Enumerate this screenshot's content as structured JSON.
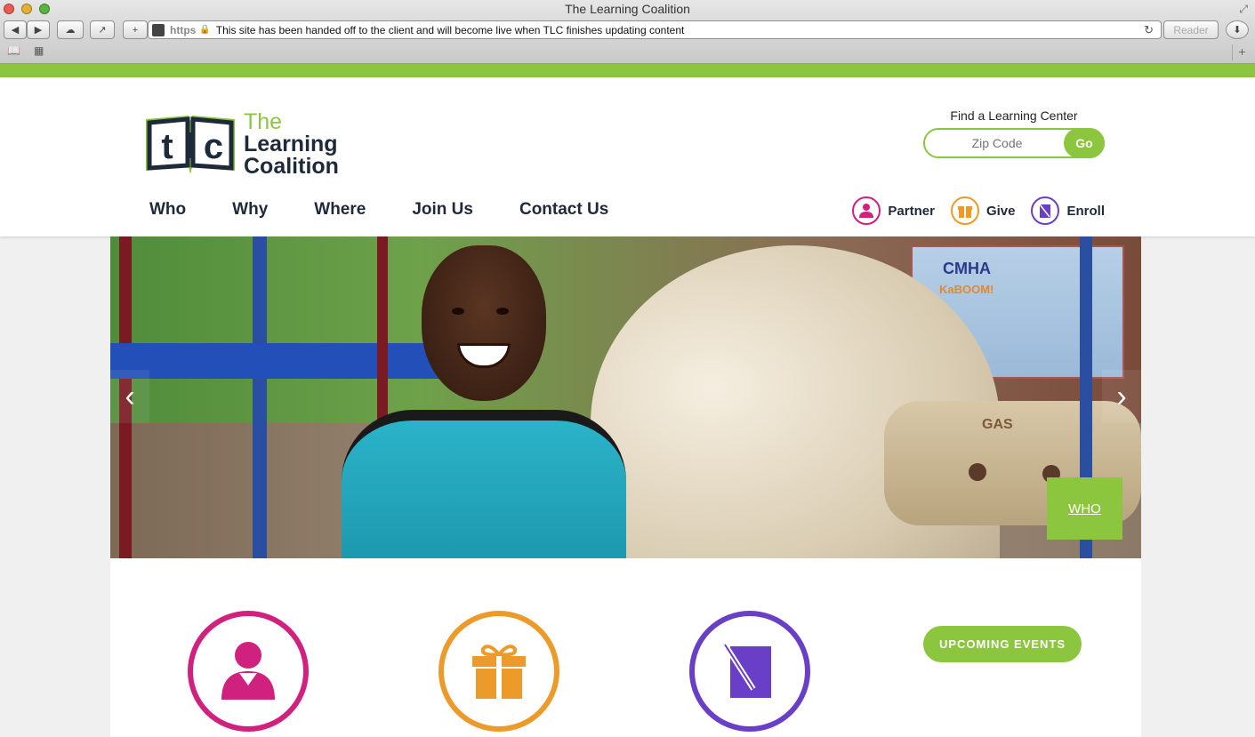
{
  "browser": {
    "title": "The Learning Coalition",
    "url_scheme": "https",
    "url_text": "This site has been handed off to the client and will become live when TLC finishes updating content",
    "reader_label": "Reader"
  },
  "brand": {
    "logo_mark": "tlc",
    "logo_line1": "The",
    "logo_line2": "Learning",
    "logo_line3": "Coalition",
    "green": "#8cc63f",
    "navy": "#1e2a3a"
  },
  "search": {
    "label": "Find a Learning Center",
    "placeholder": "Zip Code",
    "button": "Go"
  },
  "nav": {
    "items": [
      {
        "label": "Who"
      },
      {
        "label": "Why"
      },
      {
        "label": "Where"
      },
      {
        "label": "Join Us"
      },
      {
        "label": "Contact Us"
      }
    ]
  },
  "actions": [
    {
      "label": "Partner",
      "icon": "person-icon",
      "color": "#d0217f"
    },
    {
      "label": "Give",
      "icon": "gift-icon",
      "color": "#ec9a2a"
    },
    {
      "label": "Enroll",
      "icon": "form-pen-icon",
      "color": "#6a3fc8"
    }
  ],
  "hero": {
    "caption_link": "WHO",
    "mural_line1": "CMHA",
    "mural_line2": "KaBOOM!",
    "tube_label": "GAS",
    "prev_icon": "chevron-left-icon",
    "next_icon": "chevron-right-icon"
  },
  "features": {
    "events_button": "UPCOMING EVENTS"
  }
}
